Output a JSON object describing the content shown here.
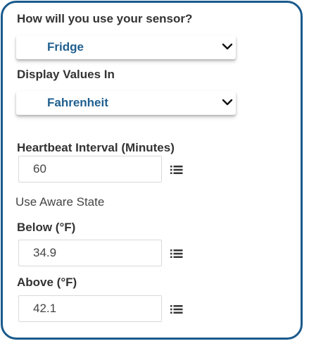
{
  "form": {
    "usage": {
      "label": "How will you use your sensor?",
      "selected": "Fridge"
    },
    "display": {
      "label": "Display Values In",
      "selected": "Fahrenheit"
    },
    "heartbeat": {
      "label": "Heartbeat Interval (Minutes)",
      "value": "60"
    },
    "aware_state": {
      "label": "Use Aware State"
    },
    "below": {
      "label": "Below (°F)",
      "value": "34.9"
    },
    "above": {
      "label": "Above (°F)",
      "value": "42.1"
    }
  },
  "icons": {
    "dropdown": "chevron-down-icon",
    "field_menu": "list-icon"
  },
  "colors": {
    "border": "#1a5a8c",
    "select_text": "#1f5f8f",
    "label_text": "#333333"
  }
}
